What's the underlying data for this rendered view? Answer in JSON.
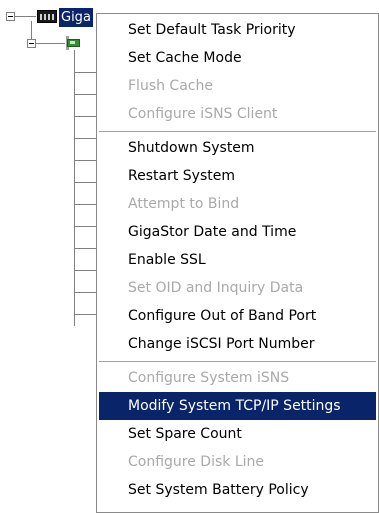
{
  "tree": {
    "root_label": "Giga",
    "root_icon": "rack-server-icon",
    "child_icon": "network-card-icon"
  },
  "context_menu": {
    "groups": [
      {
        "items": [
          {
            "label": "Set Default Task Priority",
            "enabled": true
          },
          {
            "label": "Set Cache Mode",
            "enabled": true
          },
          {
            "label": "Flush Cache",
            "enabled": false
          },
          {
            "label": "Configure iSNS Client",
            "enabled": false
          }
        ]
      },
      {
        "items": [
          {
            "label": "Shutdown System",
            "enabled": true
          },
          {
            "label": "Restart System",
            "enabled": true
          },
          {
            "label": "Attempt to Bind",
            "enabled": false
          },
          {
            "label": "GigaStor Date and Time",
            "enabled": true
          },
          {
            "label": "Enable SSL",
            "enabled": true
          },
          {
            "label": "Set OID and Inquiry Data",
            "enabled": false
          },
          {
            "label": "Configure Out of Band Port",
            "enabled": true
          },
          {
            "label": "Change iSCSI Port Number",
            "enabled": true
          }
        ]
      },
      {
        "items": [
          {
            "label": "Configure System iSNS",
            "enabled": false
          },
          {
            "label": "Modify System TCP/IP Settings",
            "enabled": true,
            "highlighted": true
          },
          {
            "label": "Set Spare Count",
            "enabled": true
          },
          {
            "label": "Configure Disk Line",
            "enabled": false
          },
          {
            "label": "Set System Battery Policy",
            "enabled": true
          }
        ]
      }
    ]
  },
  "colors": {
    "highlight": "#0a246a",
    "highlight_text": "#ffffff",
    "disabled_text": "#a9a9a9",
    "tree_line": "#808080"
  }
}
